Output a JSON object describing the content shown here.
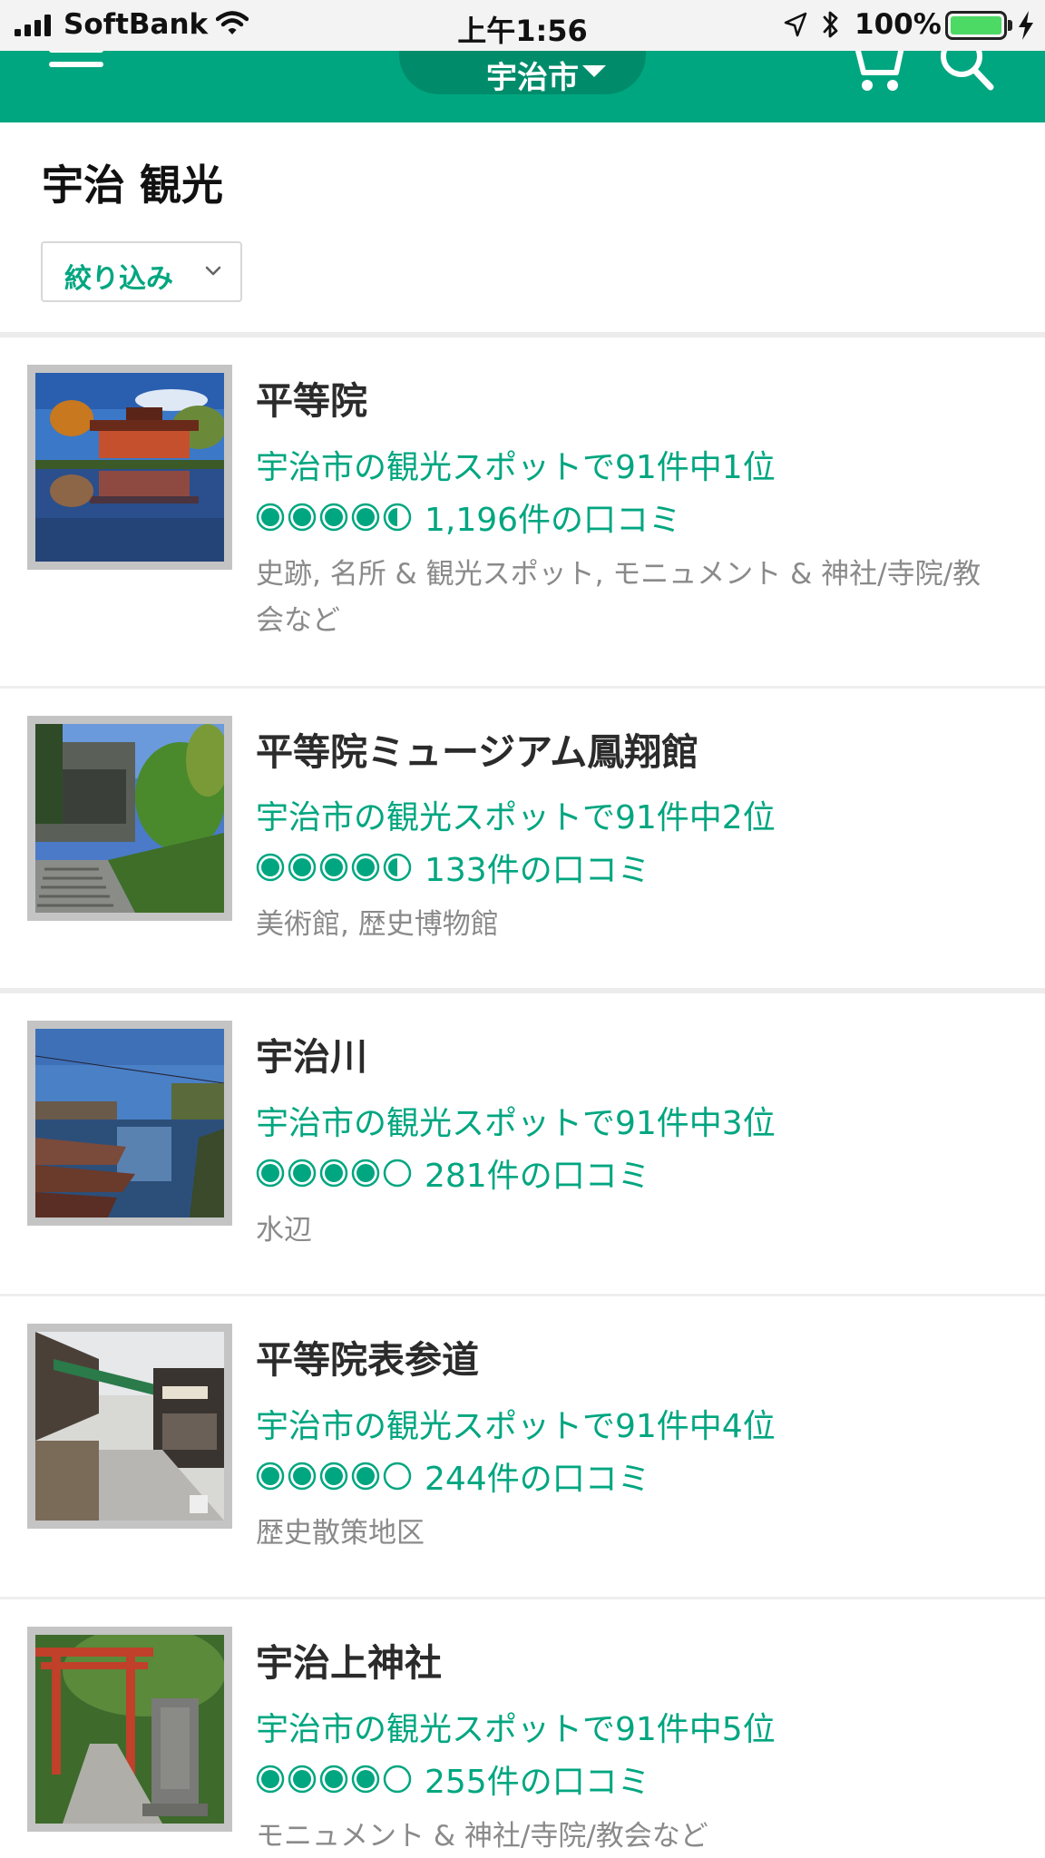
{
  "status_bar": {
    "carrier": "SoftBank",
    "time": "上午1:56",
    "battery_pct": "100%",
    "battery_level": 1.0,
    "battery_color": "#4cd964"
  },
  "header": {
    "geo_label": "宇治市",
    "brand_color": "#00a680",
    "icons": [
      "menu-icon",
      "chevron-down-icon",
      "cart-icon",
      "search-icon"
    ]
  },
  "page": {
    "title": "宇治 観光",
    "filter_label": "絞り込み"
  },
  "items": [
    {
      "name": "平等院",
      "rank": "宇治市の観光スポットで91件中1位",
      "rating": 4.5,
      "reviews": "1,196件の口コミ",
      "tags": "史跡, 名所 & 観光スポット, モニュメント & 神社/寺院/教会など"
    },
    {
      "name": "平等院ミュージアム鳳翔館",
      "rank": "宇治市の観光スポットで91件中2位",
      "rating": 4.5,
      "reviews": "133件の口コミ",
      "tags": "美術館, 歴史博物館"
    },
    {
      "name": "宇治川",
      "rank": "宇治市の観光スポットで91件中3位",
      "rating": 4,
      "reviews": "281件の口コミ",
      "tags": "水辺"
    },
    {
      "name": "平等院表参道",
      "rank": "宇治市の観光スポットで91件中4位",
      "rating": 4,
      "reviews": "244件の口コミ",
      "tags": "歴史散策地区"
    },
    {
      "name": "宇治上神社",
      "rank": "宇治市の観光スポットで91件中5位",
      "rating": 4,
      "reviews": "255件の口コミ",
      "tags": "モニュメント & 神社/寺院/教会など"
    }
  ]
}
